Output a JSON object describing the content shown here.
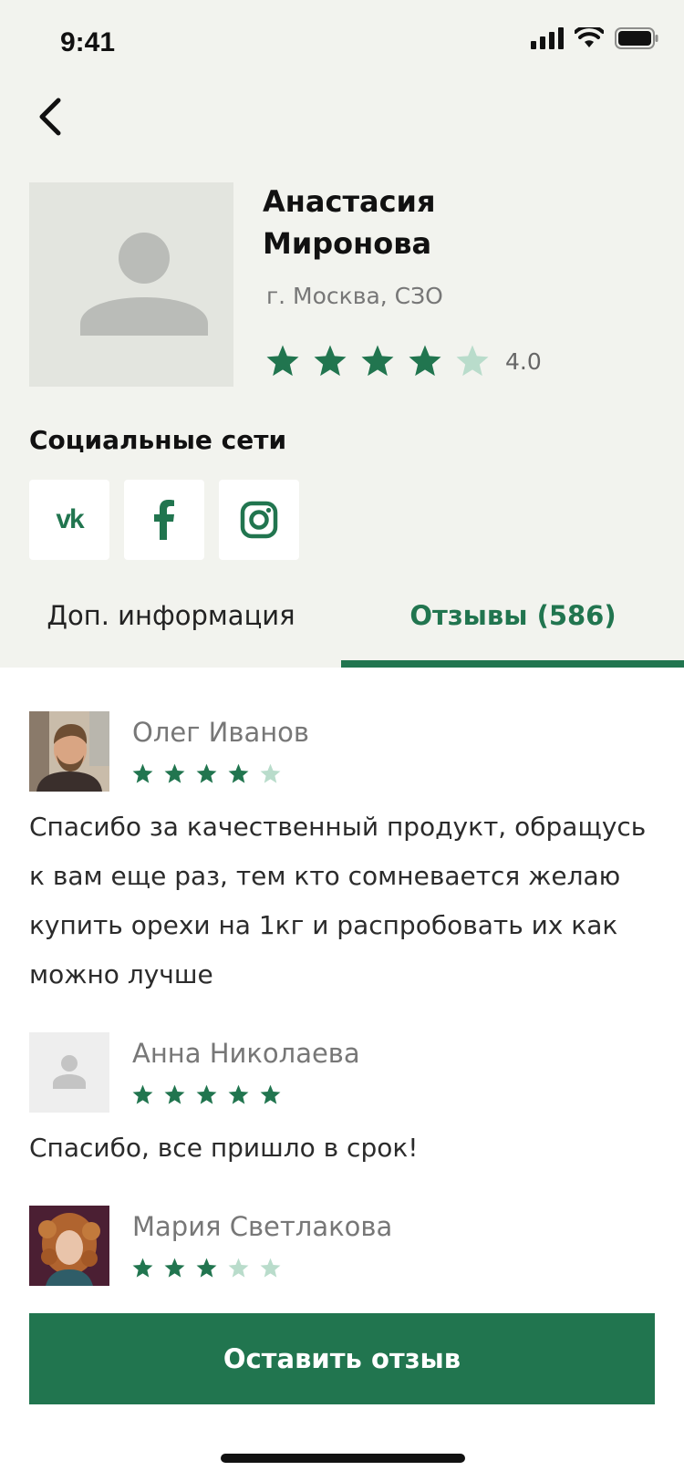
{
  "status_bar": {
    "time": "9:41"
  },
  "profile": {
    "name_line1": "Анастасия",
    "name_line2": "Миронова",
    "city": "г. Москва, СЗО",
    "rating": 4.0,
    "rating_label": "4.0"
  },
  "social": {
    "title": "Социальные сети",
    "networks": [
      "vk-icon",
      "facebook-icon",
      "instagram-icon"
    ],
    "vk_label": "vk"
  },
  "tabs": [
    {
      "label": "Доп. информация",
      "active": false
    },
    {
      "label": "Отзывы (586)",
      "active": true
    }
  ],
  "reviews": [
    {
      "author": "Олег Иванов",
      "rating": 4,
      "text": "Спасибо за качественный продукт, обращусь к вам еще раз, тем кто сомневается желаю купить орехи на 1кг и распробовать их как можно лучше"
    },
    {
      "author": "Анна Николаева",
      "rating": 5,
      "text": "Спасибо, все пришло в срок!"
    },
    {
      "author": "Мария Светлакова",
      "rating": 3,
      "text": ""
    }
  ],
  "cta": {
    "label": "Оставить отзыв"
  },
  "colors": {
    "accent": "#21754f",
    "star_empty": "#b9dccb",
    "header_bg": "#f2f3ee"
  }
}
